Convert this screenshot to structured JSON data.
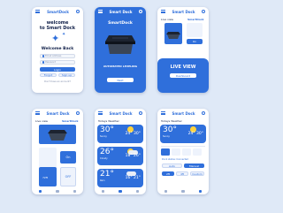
{
  "brand": {
    "name": "SmartDock",
    "accent": "#2f6fdb",
    "dark": "#12214a",
    "background": "#dfe9f7"
  },
  "login": {
    "title_line1": "welcome",
    "title_line2": "to Smart Dock",
    "subtitle": "Welcome Back",
    "email_placeholder": "Email Address",
    "password_placeholder": "Password",
    "login_button": "Login",
    "forgot_label": "Forgot",
    "signup_label": "Sign up",
    "footer": "Don't have an account?"
  },
  "leveling": {
    "header_title": "Smart Dock",
    "logo": "SmartDock",
    "status": "AUTOMATED LEVELING",
    "button": "Next"
  },
  "liveview": {
    "header_title": "Smart Dock",
    "label": "Live view",
    "logo": "SmartDock",
    "on_label": "On",
    "banner": "LIVE VIEW",
    "button": "Dashboard"
  },
  "dashboard": {
    "header_title": "Smart Dock",
    "label": "Live view",
    "logo": "SmartDock",
    "toggle_on": "On",
    "toggle_off": "OFF",
    "gauge_left": "72ft",
    "gauge_right": "72ft"
  },
  "weather": {
    "header_title": "Smart Dock",
    "section": "Todays Weather",
    "cards": [
      {
        "temp": "30°",
        "range": "24° 30°",
        "cond": "Sunny"
      },
      {
        "temp": "26°",
        "range": "18° 26°",
        "cond": "Cloudy"
      },
      {
        "temp": "21°",
        "range": "16° 21°",
        "cond": "Rain"
      }
    ]
  },
  "controls": {
    "header_title": "Smart Dock",
    "section": "Todays Weather",
    "card": {
      "temp": "30°",
      "range": "24° 30°",
      "cond": "Sunny"
    },
    "status": "Dock status: Connected",
    "mode_auto": "Auto",
    "mode_manual": "Manual",
    "chips": [
      "2ft",
      "4ft",
      "Custom"
    ]
  }
}
